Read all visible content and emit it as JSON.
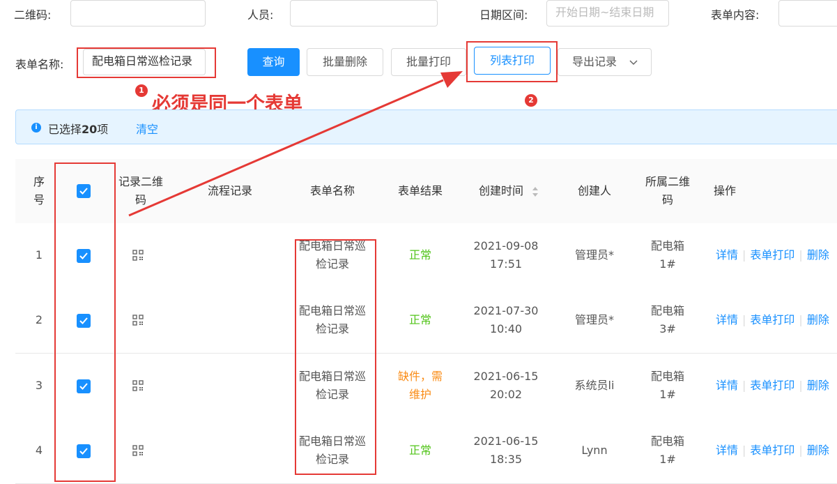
{
  "filters": {
    "qrcode_label": "二维码:",
    "person_label": "人员:",
    "date_label": "日期区间:",
    "date_placeholder": "开始日期~结束日期",
    "content_label": "表单内容:",
    "form_name_label": "表单名称:",
    "form_name_value": "配电箱日常巡检记录"
  },
  "toolbar": {
    "query": "查询",
    "batch_delete": "批量删除",
    "batch_print": "批量打印",
    "list_print": "列表打印",
    "export": "导出记录"
  },
  "annotations": {
    "marker1": "1",
    "marker2": "2",
    "note": "必须是同一个表单"
  },
  "selection": {
    "prefix": "已选择",
    "count": "20",
    "suffix": "项",
    "clear": "清空"
  },
  "columns": {
    "index": "序号",
    "qr_record": "记录二维码",
    "flow": "流程记录",
    "form_name": "表单名称",
    "form_result": "表单结果",
    "created": "创建时间",
    "creator": "创建人",
    "belong_qr": "所属二维码",
    "actions": "操作"
  },
  "rows": [
    {
      "index": "1",
      "form_name": "配电箱日常巡检记录",
      "result": "正常",
      "result_status": "ok",
      "date": "2021-09-08",
      "time": "17:51",
      "creator": "管理员*",
      "belong_line1": "配电箱",
      "belong_line2": "1#"
    },
    {
      "index": "2",
      "form_name": "配电箱日常巡检记录",
      "result": "正常",
      "result_status": "ok",
      "date": "2021-07-30",
      "time": "10:40",
      "creator": "管理员*",
      "belong_line1": "配电箱",
      "belong_line2": "3#"
    },
    {
      "index": "3",
      "form_name": "配电箱日常巡检记录",
      "result": "缺件，需维护",
      "result_status": "warn",
      "date": "2021-06-15",
      "time": "20:02",
      "creator": "系统员li",
      "belong_line1": "配电箱",
      "belong_line2": "1#"
    },
    {
      "index": "4",
      "form_name": "配电箱日常巡检记录",
      "result": "正常",
      "result_status": "ok",
      "date": "2021-06-15",
      "time": "18:35",
      "creator": "Lynn",
      "belong_line1": "配电箱",
      "belong_line2": "1#"
    }
  ],
  "row_actions": {
    "detail": "详情",
    "print": "表单打印",
    "delete": "删除"
  },
  "colors": {
    "primary": "#1890ff",
    "annotation_red": "#e53935",
    "ok_green": "#52c41a",
    "warn_orange": "#fa8c16"
  },
  "icons": [
    "info-icon",
    "checkbox-checked-icon",
    "qrcode-icon",
    "sort-icon",
    "chevron-down-icon"
  ]
}
